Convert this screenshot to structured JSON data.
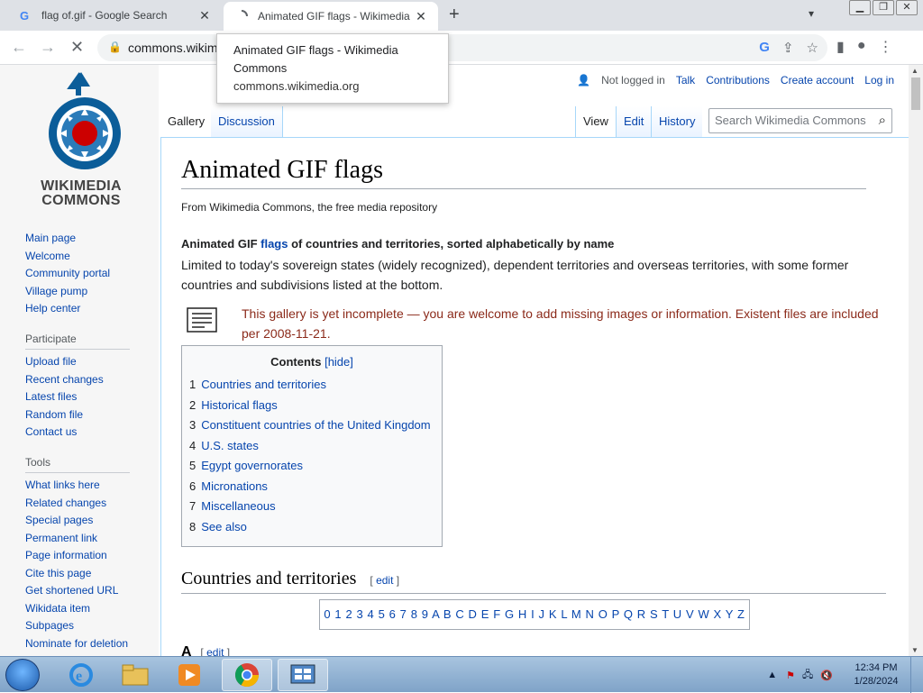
{
  "browser": {
    "tabs": [
      {
        "title": "flag of.gif - Google Search",
        "favicon": "google-g"
      },
      {
        "title": "Animated GIF flags - Wikimedia Commons",
        "favicon": "loading"
      }
    ],
    "url": "commons.wikimedia.org",
    "tooltip": {
      "title": "Animated GIF flags - Wikimedia Commons",
      "host": "commons.wikimedia.org"
    }
  },
  "wiki": {
    "logo_line1": "WIKIMEDIA",
    "logo_line2": "COMMONS",
    "nav_main": [
      "Main page",
      "Welcome",
      "Community portal",
      "Village pump",
      "Help center"
    ],
    "participate_header": "Participate",
    "nav_participate": [
      "Upload file",
      "Recent changes",
      "Latest files",
      "Random file",
      "Contact us"
    ],
    "tools_header": "Tools",
    "nav_tools": [
      "What links here",
      "Related changes",
      "Special pages",
      "Permanent link",
      "Page information",
      "Cite this page",
      "Get shortened URL",
      "Wikidata item",
      "Subpages",
      "Nominate for deletion"
    ],
    "personal": {
      "not_logged_in": "Not logged in",
      "talk": "Talk",
      "contributions": "Contributions",
      "create_account": "Create account",
      "login": "Log in"
    },
    "page_tabs": {
      "gallery": "Gallery",
      "discussion": "Discussion",
      "view": "View",
      "edit": "Edit",
      "history": "History"
    },
    "search_placeholder": "Search Wikimedia Commons",
    "title": "Animated GIF flags",
    "from": "From Wikimedia Commons, the free media repository",
    "lead_pre": "Animated GIF ",
    "lead_link": "flags",
    "lead_post": " of countries and territories, sorted alphabetically by name",
    "desc": "Limited to today's sovereign states (widely recognized), dependent territories and overseas territories, with some former countries and subdivisions listed at the bottom.",
    "notice": "This gallery is yet incomplete — you are welcome to add missing images or information. Existent files are included per 2008-11-21.",
    "toc_title": "Contents",
    "toc_hide": "[hide]",
    "toc": [
      {
        "n": "1",
        "label": "Countries and territories"
      },
      {
        "n": "2",
        "label": "Historical flags"
      },
      {
        "n": "3",
        "label": "Constituent countries of the United Kingdom"
      },
      {
        "n": "4",
        "label": "U.S. states"
      },
      {
        "n": "5",
        "label": "Egypt governorates"
      },
      {
        "n": "6",
        "label": "Micronations"
      },
      {
        "n": "7",
        "label": "Miscellaneous"
      },
      {
        "n": "8",
        "label": "See also"
      }
    ],
    "section_title": "Countries and territories",
    "edit_open": "[ ",
    "edit_link": "edit",
    "edit_close": " ]",
    "alphabet": "0 1 2 3 4 5 6 7 8 9 A B C D E F G H I J K L M N O P Q R S T U V W X Y Z",
    "sub_title": "A",
    "sub_edit_open": "[ ",
    "sub_edit_link": "edit",
    "sub_edit_close": " ]"
  },
  "taskbar": {
    "time": "12:34 PM",
    "date": "1/28/2024"
  }
}
